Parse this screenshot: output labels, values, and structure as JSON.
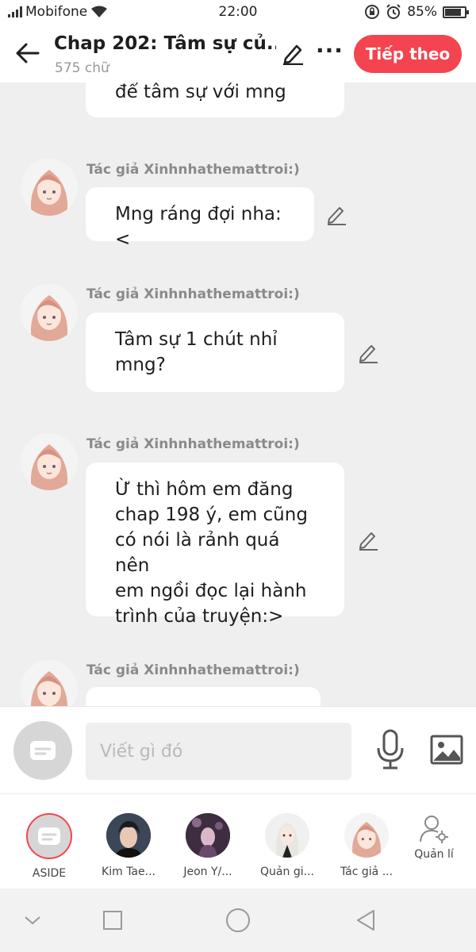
{
  "status": {
    "carrier": "Mobifone",
    "time": "22:00",
    "battery": "85%",
    "battery_level": 0.85
  },
  "header": {
    "title": "Chap 202: Tâm sự củ...",
    "subtitle": "575 chữ",
    "next_label": "Tiếp theo"
  },
  "messages": [
    {
      "author": "",
      "lines": [
        "để tâm sự với mng"
      ]
    },
    {
      "author": "Tác giả Xinhnhathemattroi:)",
      "lines": [
        "Mng ráng đợi nha:<"
      ]
    },
    {
      "author": "Tác giả Xinhnhathemattroi:)",
      "lines": [
        "Tâm sự 1 chút nhỉ",
        "mng?"
      ]
    },
    {
      "author": "Tác giả Xinhnhathemattroi:)",
      "lines": [
        "Ừ thì hôm em đăng",
        "chap 198 ý, em cũng",
        "có nói là rảnh quá nên",
        "em ngồi đọc lại hành",
        "trình của truyện:>"
      ]
    },
    {
      "author": "Tác giả Xinhnhathemattroi:)",
      "lines": [
        ""
      ]
    }
  ],
  "composer": {
    "placeholder": "Viết gì đó"
  },
  "characters": [
    {
      "label": "ASIDE"
    },
    {
      "label": "Kim Tae..."
    },
    {
      "label": "Jeon Y/..."
    },
    {
      "label": "Quản gi..."
    },
    {
      "label": "Tác giả ..."
    }
  ],
  "manage_label": "Quản lí",
  "colors": {
    "accent": "#f44450",
    "background": "#efefef",
    "bubble": "#ffffff"
  }
}
